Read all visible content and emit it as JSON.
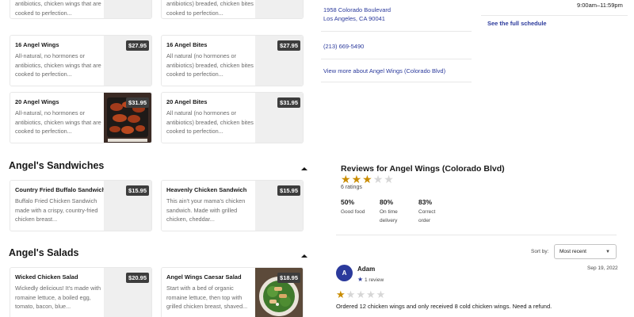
{
  "menu": {
    "top_cut_items": [
      {
        "description": "antibiotics, chicken wings that are cooked to perfection..."
      },
      {
        "description": "antibiotics) breaded, chicken bites cooked to perfection..."
      }
    ],
    "wings_rows": [
      [
        {
          "name": "16 Angel Wings",
          "price": "$27.95",
          "description": "All-natural, no hormones or antibiotics, chicken wings that are cooked to perfection..."
        },
        {
          "name": "16 Angel Bites",
          "price": "$27.95",
          "description": "All natural (no hormones or antibiotics) breaded, chicken bites cooked to perfection..."
        }
      ],
      [
        {
          "name": "20 Angel Wings",
          "price": "$31.95",
          "description": "All-natural, no hormones or antibiotics, chicken wings that are cooked to perfection..."
        },
        {
          "name": "20 Angel Bites",
          "price": "$31.95",
          "description": "All natural (no hormones or antibiotics) breaded, chicken bites cooked to perfection..."
        }
      ]
    ],
    "sandwiches": {
      "title": "Angel's Sandwiches",
      "items": [
        {
          "name": "Country Fried Buffalo Sandwich",
          "price": "$15.95",
          "description": "Buffalo Fried Chicken Sandwich made with a crispy, country-fried chicken breast..."
        },
        {
          "name": "Heavenly Chicken Sandwich",
          "price": "$15.95",
          "description": "This ain't your mama's chicken sandwich. Made with grilled chicken, cheddar..."
        }
      ]
    },
    "salads": {
      "title": "Angel's Salads",
      "items": [
        {
          "name": "Wicked Chicken Salad",
          "price": "$20.95",
          "description": "Wickedly delicious! It's made with romaine lettuce, a boiled egg, tomato, bacon, blue..."
        },
        {
          "name": "Angel Wings Caesar Salad",
          "price": "$18.95",
          "description": "Start with a bed of organic romaine lettuce, then top with grilled chicken breast, shaved..."
        }
      ]
    }
  },
  "store_info": {
    "address_line1": "1958 Colorado Boulevard",
    "address_line2": "Los Angeles, CA 90041",
    "phone": "(213) 669-5490",
    "more_about": "View more about Angel Wings (Colorado Blvd)",
    "hours": "9:00am–11:59pm",
    "full_schedule": "See the full schedule"
  },
  "reviews": {
    "title": "Reviews for Angel Wings (Colorado Blvd)",
    "rating": 3,
    "max_rating": 5,
    "ratings_count": "6 ratings",
    "stats": [
      {
        "value": "50%",
        "label": "Good food"
      },
      {
        "value": "80%",
        "label": "On time delivery"
      },
      {
        "value": "83%",
        "label": "Correct order"
      }
    ],
    "sort_label": "Sort by:",
    "sort_value": "Most recent",
    "items": [
      {
        "avatar_letter": "A",
        "name": "Adam",
        "badge": "1 review",
        "date": "Sep 19, 2022",
        "rating": 1,
        "text": "Ordered 12 chicken wings and only received 8 cold chicken wings. Need a refund."
      }
    ]
  },
  "colors": {
    "accent": "#2b3a9c",
    "star": "#c98c00",
    "price_badge": "#3d3d3d"
  }
}
